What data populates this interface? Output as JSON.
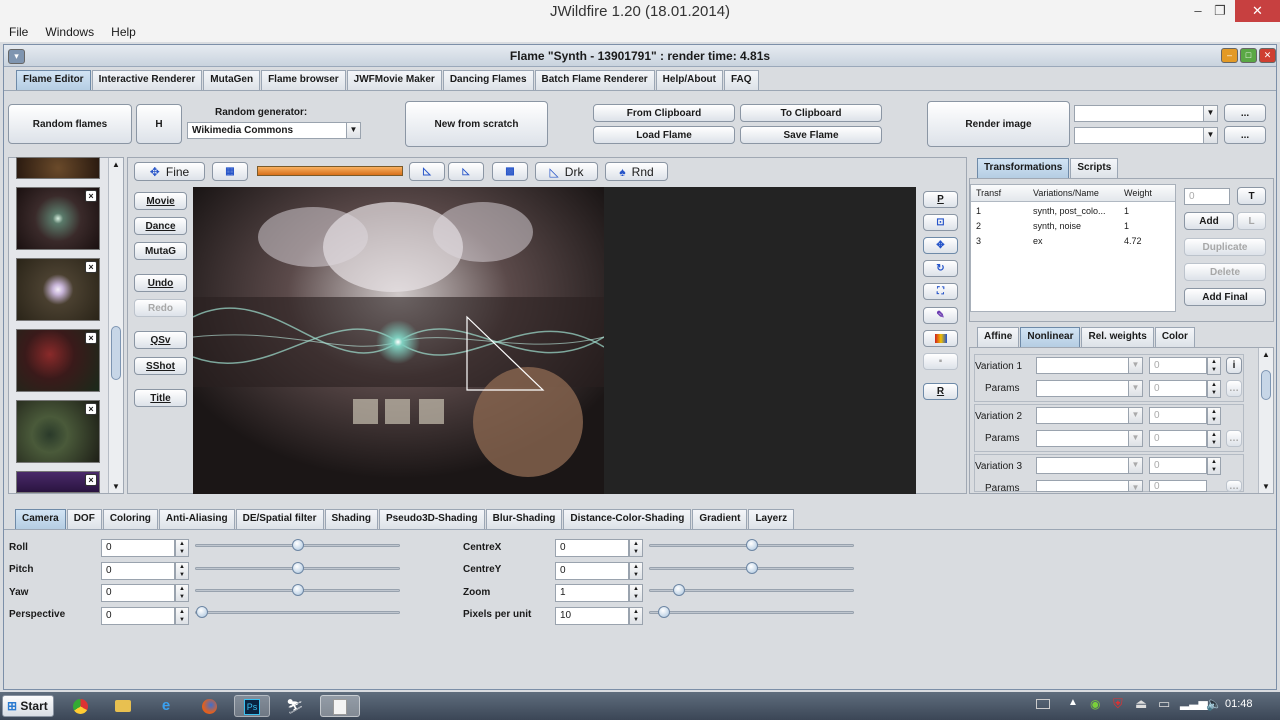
{
  "window": {
    "title": "JWildfire 1.20 (18.01.2014)",
    "min": "–",
    "max": "❐",
    "close": "✕"
  },
  "menu": [
    "File",
    "Windows",
    "Help"
  ],
  "inner": {
    "title": "Flame \"Synth - 13901791\" : render time: 4.81s"
  },
  "main_tabs": [
    "Flame Editor",
    "Interactive Renderer",
    "MutaGen",
    "Flame browser",
    "JWFMovie Maker",
    "Dancing Flames",
    "Batch Flame Renderer",
    "Help/About",
    "FAQ"
  ],
  "toolbar": {
    "random_flames": "Random flames",
    "h": "H",
    "random_generator_label": "Random generator:",
    "random_generator_value": "Wikimedia Commons",
    "new_from_scratch": "New from scratch",
    "from_clipboard": "From Clipboard",
    "to_clipboard": "To Clipboard",
    "load_flame": "Load Flame",
    "save_flame": "Save Flame",
    "render_image": "Render image",
    "ellipsis": "..."
  },
  "preview_toolbar": {
    "fine": "Fine",
    "drk": "Drk",
    "rnd": "Rnd",
    "fine_icon": "move-icon",
    "drk_icon": "triangle-icon",
    "rnd_icon": "spade-icon"
  },
  "left_buttons": {
    "movie": "Movie",
    "dance": "Dance",
    "mutag": "MutaG",
    "undo": "Undo",
    "redo": "Redo",
    "qsv": "QSv",
    "sshot": "SShot",
    "title": "Title"
  },
  "right_tools": {
    "p": "P",
    "r": "R"
  },
  "transform_tabs": [
    "Transformations",
    "Scripts"
  ],
  "transform_table": {
    "headers": [
      "Transf",
      "Variations/Name",
      "Weight"
    ],
    "rows": [
      [
        "1",
        "synth, post_colo...",
        "1"
      ],
      [
        "2",
        "synth, noise",
        "1"
      ],
      [
        "3",
        "ex",
        "4.72"
      ]
    ]
  },
  "transform_buttons": {
    "spin_value": "0",
    "t": "T",
    "add": "Add",
    "l": "L",
    "duplicate": "Duplicate",
    "delete": "Delete",
    "add_final": "Add Final"
  },
  "var_tabs": [
    "Affine",
    "Nonlinear",
    "Rel. weights",
    "Color"
  ],
  "variations": [
    {
      "label": "Variation 1",
      "params": "Params",
      "value": "0",
      "params_value": "0"
    },
    {
      "label": "Variation 2",
      "params": "Params",
      "value": "0",
      "params_value": "0"
    },
    {
      "label": "Variation 3",
      "params": "Params",
      "value": "0",
      "params_value": "0"
    }
  ],
  "var_info": "i",
  "bottom_tabs": [
    "Camera",
    "DOF",
    "Coloring",
    "Anti-Aliasing",
    "DE/Spatial filter",
    "Shading",
    "Pseudo3D-Shading",
    "Blur-Shading",
    "Distance-Color-Shading",
    "Gradient",
    "Layerz"
  ],
  "camera_left": [
    {
      "label": "Roll",
      "value": "0",
      "slider": 0.5
    },
    {
      "label": "Pitch",
      "value": "0",
      "slider": 0.5
    },
    {
      "label": "Yaw",
      "value": "0",
      "slider": 0.5
    },
    {
      "label": "Perspective",
      "value": "0",
      "slider": 0.0
    }
  ],
  "camera_right": [
    {
      "label": "CentreX",
      "value": "0",
      "slider": 0.5
    },
    {
      "label": "CentreY",
      "value": "0",
      "slider": 0.5
    },
    {
      "label": "Zoom",
      "value": "1",
      "slider": 0.12
    },
    {
      "label": "Pixels per unit",
      "value": "10",
      "slider": 0.04
    }
  ],
  "taskbar": {
    "start": "Start",
    "clock": "01:48",
    "apps": [
      "chrome-icon",
      "folder-icon",
      "ie-icon",
      "firefox-icon",
      "photoshop-icon",
      "app-icon",
      "java-icon"
    ],
    "ps": "Ps"
  },
  "colors": {
    "accent": "#6e8aa8",
    "progress": "#e07b1a",
    "close_red": "#c74040"
  }
}
